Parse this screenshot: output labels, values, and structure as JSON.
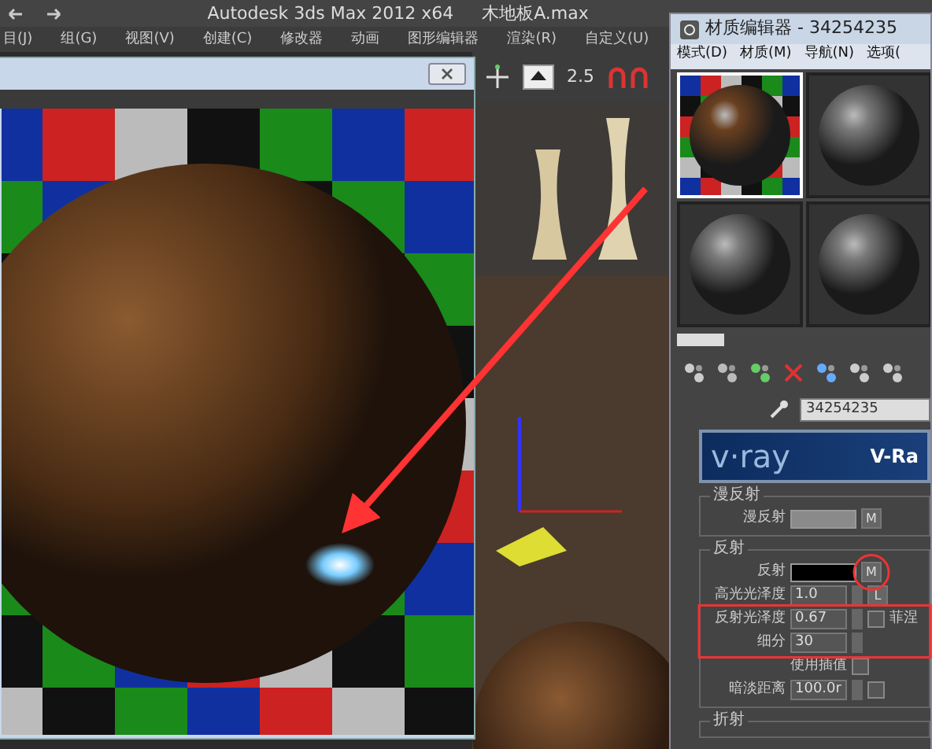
{
  "app_title": {
    "title": "Autodesk 3ds Max  2012 x64",
    "file": "木地板A.max"
  },
  "menu": [
    "目(J)",
    "组(G)",
    "视图(V)",
    "创建(C)",
    "修改器",
    "动画",
    "图形编辑器",
    "渲染(R)",
    "自定义(U)"
  ],
  "toolbar": {
    "snap_value": "2.5"
  },
  "material_editor": {
    "title": "材质编辑器 - 34254235",
    "menu": [
      "模式(D)",
      "材质(M)",
      "导航(N)",
      "选项("
    ],
    "slots": [
      {
        "kind": "wood",
        "selected": true
      },
      {
        "kind": "gray",
        "selected": false
      },
      {
        "kind": "gray",
        "selected": false
      },
      {
        "kind": "gray",
        "selected": false
      }
    ],
    "material_name": "34254235",
    "banner": {
      "logo": "v·ray",
      "text": "V-Ra"
    },
    "groups": [
      {
        "title": "漫反射",
        "rows": [
          {
            "kind": "swatch",
            "label": "漫反射",
            "color": "#8a8a8a",
            "button": "M"
          }
        ]
      },
      {
        "title": "反射",
        "rows": [
          {
            "kind": "swatch",
            "label": "反射",
            "color": "#000000",
            "button": "M"
          },
          {
            "kind": "spinner",
            "label": "高光光泽度",
            "value": "1.0",
            "button": "L"
          },
          {
            "kind": "spinner",
            "label": "反射光泽度",
            "value": "0.67",
            "check_label": "菲涅",
            "checked": false
          },
          {
            "kind": "spinner",
            "label": "细分",
            "value": "30"
          },
          {
            "kind": "check",
            "label": "使用插值",
            "checked": false
          },
          {
            "kind": "spinner",
            "label": "暗淡距离",
            "value": "100.0r",
            "checked": false
          }
        ]
      },
      {
        "title": "折射"
      }
    ]
  },
  "annotations": [
    {
      "kind": "arrow"
    },
    {
      "kind": "circle"
    },
    {
      "kind": "box"
    }
  ]
}
